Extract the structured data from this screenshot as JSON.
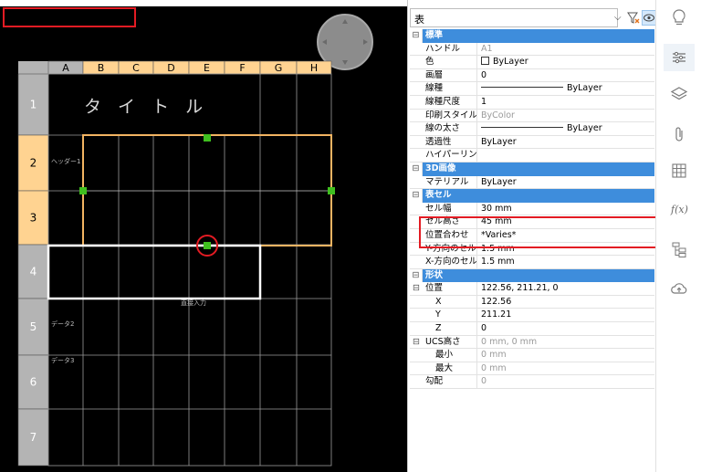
{
  "viewport": {
    "columns": [
      "A",
      "B",
      "C",
      "D",
      "E",
      "F",
      "G",
      "H"
    ],
    "rows": [
      "1",
      "2",
      "3",
      "4",
      "5",
      "6",
      "7"
    ],
    "title_text": "タ イ ト ル",
    "header_text": "ヘッダー1",
    "direct_input_text": "直接入力",
    "data2_text": "データ2",
    "data3_text": "データ3"
  },
  "selector": {
    "value": "表"
  },
  "properties": {
    "general": {
      "title": "標準",
      "rows": [
        {
          "name": "ハンドル",
          "value": "A1",
          "readonly": true
        },
        {
          "name": "色",
          "value": "ByLayer",
          "kind": "color"
        },
        {
          "name": "画層",
          "value": "0"
        },
        {
          "name": "線種",
          "value": "ByLayer",
          "kind": "line"
        },
        {
          "name": "線種尺度",
          "value": "1"
        },
        {
          "name": "印刷スタイル",
          "value": "ByColor",
          "readonly": true
        },
        {
          "name": "線の太さ",
          "value": "ByLayer",
          "kind": "line"
        },
        {
          "name": "透過性",
          "value": "ByLayer"
        },
        {
          "name": "ハイパーリンク",
          "value": ""
        }
      ]
    },
    "visual3d": {
      "title": "3D画像",
      "rows": [
        {
          "name": "マテリアル",
          "value": "ByLayer"
        }
      ]
    },
    "table_cell": {
      "title": "表セル",
      "rows": [
        {
          "name": "セル幅",
          "value": "30 mm"
        },
        {
          "name": "セル高さ",
          "value": "45 mm"
        },
        {
          "name": "位置合わせ",
          "value": "*Varies*"
        },
        {
          "name": "Y-方向のセル間隔",
          "value": "1.5 mm"
        },
        {
          "name": "X-方向のセル間隔",
          "value": "1.5 mm"
        }
      ]
    },
    "geometry": {
      "title": "形状",
      "rows": [
        {
          "name": "位置",
          "value": "122.56, 211.21, 0",
          "toggle": true
        },
        {
          "name": "X",
          "value": "122.56",
          "sub": true
        },
        {
          "name": "Y",
          "value": "211.21",
          "sub": true
        },
        {
          "name": "Z",
          "value": "0",
          "sub": true
        },
        {
          "name": "UCS高さ",
          "value": "0 mm, 0 mm",
          "readonly": true,
          "toggle": true
        },
        {
          "name": "最小",
          "value": "0 mm",
          "readonly": true,
          "sub": true
        },
        {
          "name": "最大",
          "value": "0 mm",
          "readonly": true,
          "sub": true
        },
        {
          "name": "勾配",
          "value": "0",
          "readonly": true
        }
      ]
    }
  },
  "colors": {
    "section": "#3e8ddc",
    "highlight": "#e31b23",
    "header_cell": "#ffd391",
    "header_gray": "#b4b4b4",
    "grip": "#3fbf1f",
    "selection": "#f2b462"
  },
  "icons": [
    "lightbulb-icon",
    "properties-icon",
    "layers-icon",
    "attach-icon",
    "grid-icon",
    "formula-icon",
    "hierarchy-icon",
    "cloud-upload-icon"
  ]
}
